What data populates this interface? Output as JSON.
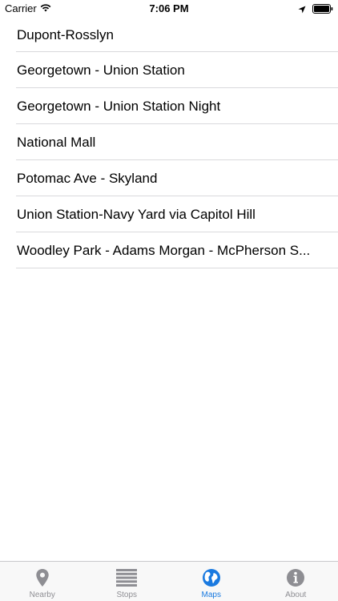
{
  "status_bar": {
    "carrier": "Carrier",
    "time": "7:06 PM"
  },
  "maps": [
    {
      "label": "Dupont-Rosslyn"
    },
    {
      "label": "Georgetown - Union Station"
    },
    {
      "label": "Georgetown - Union Station Night"
    },
    {
      "label": "National Mall"
    },
    {
      "label": "Potomac Ave - Skyland"
    },
    {
      "label": "Union Station-Navy Yard via Capitol Hill"
    },
    {
      "label": "Woodley Park - Adams Morgan - McPherson S..."
    }
  ],
  "tab_bar": {
    "active_color": "#1a7ae0",
    "inactive_color": "#8e8e93",
    "tabs": [
      {
        "label": "Nearby",
        "icon": "location-pin-icon",
        "active": false
      },
      {
        "label": "Stops",
        "icon": "list-icon",
        "active": false
      },
      {
        "label": "Maps",
        "icon": "globe-icon",
        "active": true
      },
      {
        "label": "About",
        "icon": "info-icon",
        "active": false
      }
    ]
  }
}
